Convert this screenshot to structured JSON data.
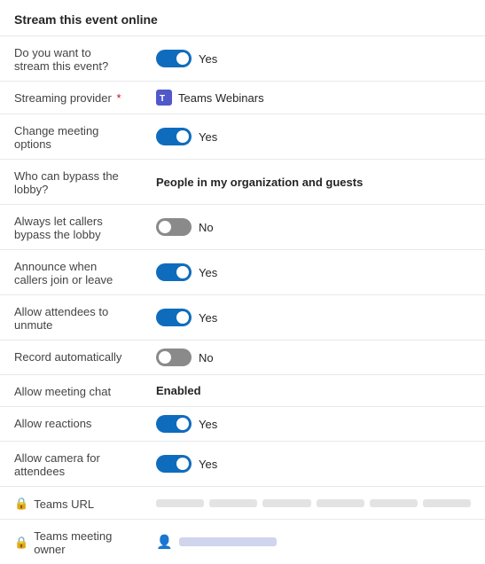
{
  "page": {
    "title": "Stream this event online"
  },
  "rows": [
    {
      "label": "Do you want to stream this event?",
      "type": "toggle",
      "state": "on",
      "value_label": "Yes"
    },
    {
      "label": "Streaming provider",
      "required": true,
      "type": "provider",
      "provider_name": "Teams Webinars"
    },
    {
      "label": "Change meeting options",
      "type": "toggle",
      "state": "on",
      "value_label": "Yes"
    },
    {
      "label": "Who can bypass the lobby?",
      "type": "bold-text",
      "value_label": "People in my organization and guests"
    },
    {
      "label": "Always let callers bypass the lobby",
      "type": "toggle",
      "state": "off",
      "value_label": "No"
    },
    {
      "label": "Announce when callers join or leave",
      "type": "toggle",
      "state": "on",
      "value_label": "Yes"
    },
    {
      "label": "Allow attendees to unmute",
      "type": "toggle",
      "state": "on",
      "value_label": "Yes"
    },
    {
      "label": "Record automatically",
      "type": "toggle",
      "state": "off",
      "value_label": "No"
    },
    {
      "label": "Allow meeting chat",
      "type": "bold-text",
      "value_label": "Enabled"
    },
    {
      "label": "Allow reactions",
      "type": "toggle",
      "state": "on",
      "value_label": "Yes"
    },
    {
      "label": "Allow camera for attendees",
      "type": "toggle",
      "state": "on",
      "value_label": "Yes"
    },
    {
      "label": "Teams URL",
      "type": "url",
      "has_lock": true
    },
    {
      "label": "Teams meeting owner",
      "type": "owner",
      "has_lock": true
    }
  ]
}
